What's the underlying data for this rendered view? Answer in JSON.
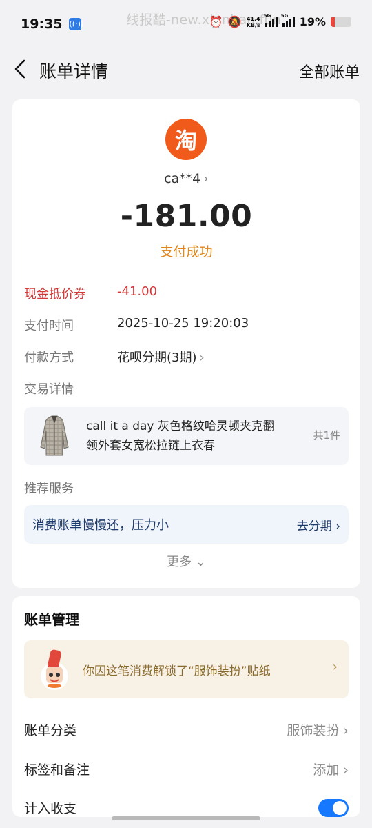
{
  "status_bar": {
    "time": "19:35",
    "watermark": "线报酷-new.xianbao.fun",
    "net_speed_top": "41.4",
    "net_speed_unit": "KB/s",
    "signal1": "5G",
    "signal2": "5G",
    "battery_pct": "19%",
    "battery_level": 0.19,
    "battery_color": "#e7473c"
  },
  "nav": {
    "title": "账单详情",
    "all_bills": "全部账单"
  },
  "bill": {
    "merchant_logo_char": "淘",
    "merchant_name": "ca**4",
    "amount": "-181.00",
    "status": "支付成功",
    "rows": {
      "voucher_label": "现金抵价券",
      "voucher_value": "-41.00",
      "time_label": "支付时间",
      "time_value": "2025-10-25 19:20:03",
      "method_label": "付款方式",
      "method_value": "花呗分期(3期)",
      "trade_label": "交易详情"
    },
    "product": {
      "title": "call it a day 灰色格纹哈灵顿夹克翻领外套女宽松拉链上衣春",
      "count": "共1件"
    },
    "recommend_label": "推荐服务",
    "recommend_text": "消费账单慢慢还，压力小",
    "recommend_action": "去分期",
    "more": "更多"
  },
  "management": {
    "title": "账单管理",
    "sticker_text": "你因这笔消费解锁了“服饰装扮”贴纸",
    "category_label": "账单分类",
    "category_value": "服饰装扮",
    "tags_label": "标签和备注",
    "tags_value": "添加",
    "income_label": "计入收支",
    "income_enabled": true
  },
  "colors": {
    "accent_orange": "#e2841a",
    "voucher_red": "#d23a3a",
    "toggle_blue": "#1677ff",
    "taobao_orange": "#f05a1a"
  }
}
